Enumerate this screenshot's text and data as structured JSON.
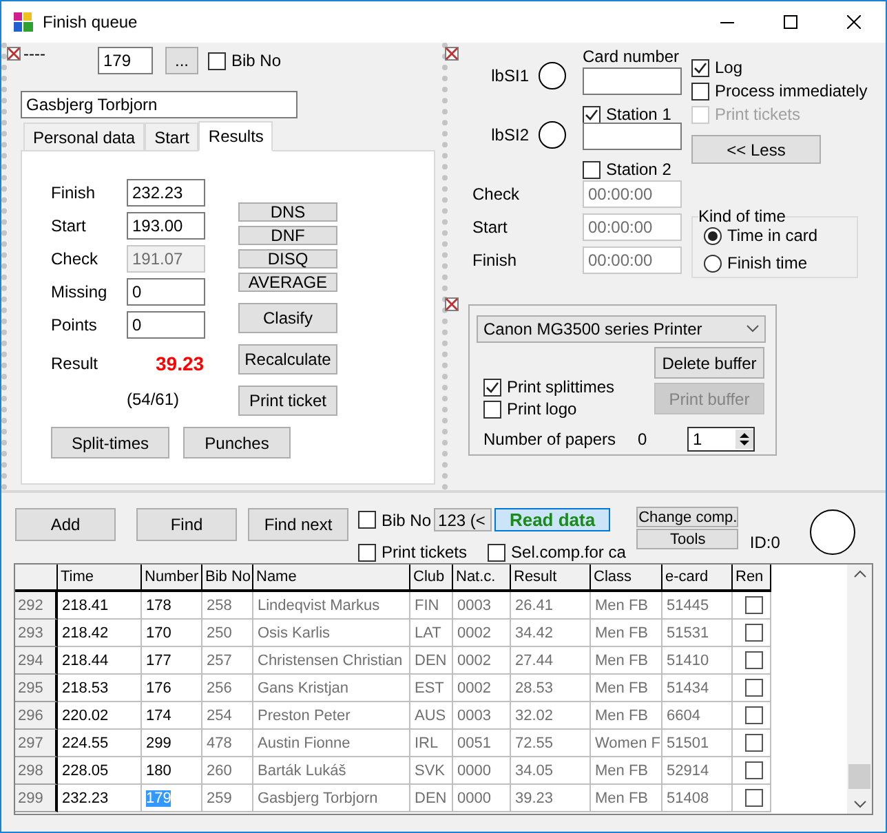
{
  "window": {
    "title": "Finish queue"
  },
  "header": {
    "dash_label": "----",
    "number": "179",
    "browse_button": "...",
    "bib_no": {
      "label": "Bib No",
      "checked": false
    },
    "name": "Gasbjerg Torbjorn"
  },
  "tabs": [
    {
      "label": "Personal data",
      "selected": false
    },
    {
      "label": "Start",
      "selected": false
    },
    {
      "label": "Results",
      "selected": true
    }
  ],
  "results": {
    "fields": [
      {
        "label": "Finish",
        "value": "232.23",
        "disabled": false
      },
      {
        "label": "Start",
        "value": "193.00",
        "disabled": false
      },
      {
        "label": "Check",
        "value": "191.07",
        "disabled": true
      },
      {
        "label": "Missing",
        "value": "0",
        "disabled": false
      },
      {
        "label": "Points",
        "value": "0",
        "disabled": false
      }
    ],
    "result_label": "Result",
    "result_value": "39.23",
    "rank": "(54/61)",
    "status_buttons": [
      "DNS",
      "DNF",
      "DISQ",
      "AVERAGE"
    ],
    "action_buttons": [
      "Clasify",
      "Recalculate",
      "Print ticket"
    ],
    "bottom_buttons": [
      "Split-times",
      "Punches"
    ]
  },
  "reader": {
    "card_number_label": "Card number",
    "stations": [
      {
        "indicator": "lbSI1",
        "label": "Station 1",
        "checked": true
      },
      {
        "indicator": "lbSI2",
        "label": "Station 2",
        "checked": false
      }
    ],
    "options": [
      {
        "label": "Log",
        "checked": true,
        "disabled": false
      },
      {
        "label": "Process immediately",
        "checked": false,
        "disabled": false
      },
      {
        "label": "Print tickets",
        "checked": false,
        "disabled": true
      }
    ],
    "less_button": "<< Less",
    "times": [
      {
        "label": "Check",
        "value": "00:00:00"
      },
      {
        "label": "Start",
        "value": "00:00:00"
      },
      {
        "label": "Finish",
        "value": "00:00:00"
      }
    ],
    "kind_of_time": {
      "title": "Kind of time",
      "options": [
        {
          "label": "Time in card",
          "selected": true
        },
        {
          "label": "Finish time",
          "selected": false
        }
      ]
    }
  },
  "printer": {
    "printer": "Canon MG3500 series Printer",
    "options": [
      {
        "label": "Print splittimes",
        "checked": true
      },
      {
        "label": "Print logo",
        "checked": false
      }
    ],
    "buttons": [
      {
        "label": "Delete buffer",
        "disabled": false
      },
      {
        "label": "Print buffer",
        "disabled": true
      }
    ],
    "papers_label": "Number of papers",
    "papers_count": "0",
    "copies": "1"
  },
  "toolbar": {
    "buttons": [
      "Add",
      "Find",
      "Find next"
    ],
    "bib_no": {
      "label": "Bib No",
      "checked": false
    },
    "search": "123 (<",
    "read_button": "Read data",
    "print_tickets": {
      "label": "Print tickets",
      "checked": false
    },
    "sel_comp": {
      "label": "Sel.comp.for ca",
      "checked": false
    },
    "side_buttons": [
      "Change comp.",
      "Tools"
    ],
    "id": "ID:0"
  },
  "table": {
    "columns": [
      "Time",
      "Number",
      "Bib No",
      "Name",
      "Club",
      "Nat.c.",
      "Result",
      "Class",
      "e-card",
      "Ren"
    ],
    "rows": [
      {
        "index": "292",
        "cells": [
          "218.41",
          "178",
          "258",
          "Lindeqvist Markus",
          "FIN",
          "0003",
          "26.41",
          "Men FB",
          "51445"
        ],
        "ren": false,
        "selected": false
      },
      {
        "index": "293",
        "cells": [
          "218.42",
          "170",
          "250",
          "Osis Karlis",
          "LAT",
          "0002",
          "34.42",
          "Men FB",
          "51531"
        ],
        "ren": false,
        "selected": false
      },
      {
        "index": "294",
        "cells": [
          "218.44",
          "177",
          "257",
          "Christensen Christian",
          "DEN",
          "0002",
          "27.44",
          "Men FB",
          "51410"
        ],
        "ren": false,
        "selected": false
      },
      {
        "index": "295",
        "cells": [
          "218.53",
          "176",
          "256",
          "Gans Kristjan",
          "EST",
          "0002",
          "28.53",
          "Men FB",
          "51434"
        ],
        "ren": false,
        "selected": false
      },
      {
        "index": "296",
        "cells": [
          "220.02",
          "174",
          "254",
          "Preston Peter",
          "AUS",
          "0003",
          "32.02",
          "Men FB",
          "6604"
        ],
        "ren": false,
        "selected": false
      },
      {
        "index": "297",
        "cells": [
          "224.55",
          "299",
          "478",
          "Austin Fionne",
          "IRL",
          "0051",
          "72.55",
          "Women F",
          "51501"
        ],
        "ren": false,
        "selected": false
      },
      {
        "index": "298",
        "cells": [
          "228.05",
          "180",
          "260",
          "Barták Lukáš",
          "SVK",
          "0000",
          "34.05",
          "Men FB",
          "52914"
        ],
        "ren": false,
        "selected": false
      },
      {
        "index": "299",
        "cells": [
          "232.23",
          "179",
          "259",
          "Gasbjerg Torbjorn",
          "DEN",
          "0000",
          "39.23",
          "Men FB",
          "51408"
        ],
        "ren": false,
        "selected": true
      }
    ]
  }
}
